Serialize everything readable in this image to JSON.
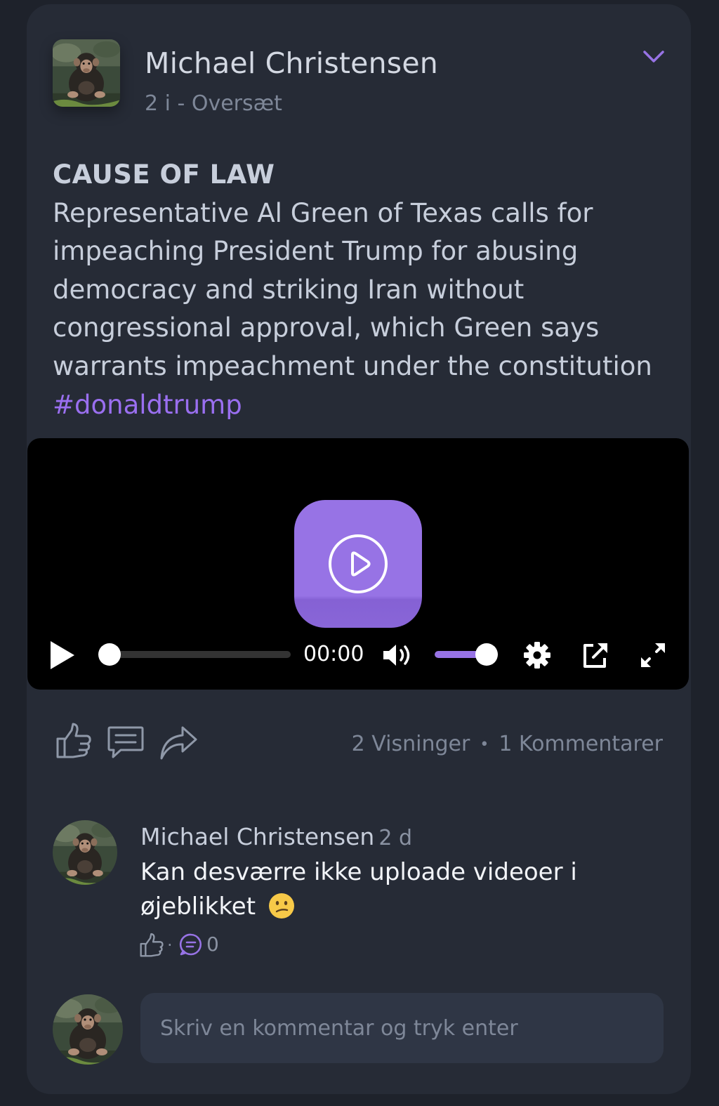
{
  "post": {
    "author": "Michael Christensen",
    "meta": "2 i - Oversæt",
    "headline": "CAUSE OF LAW",
    "body": "Representative Al Green of Texas calls for impeaching President Trump for abusing democracy and striking Iran without congressional approval, which Green says warrants impeachment under the constitution ",
    "hashtag": "#donaldtrump",
    "avatar_icon": "chimpanzee-photo",
    "menu_icon": "chevron-down-icon"
  },
  "video": {
    "time": "00:00",
    "progress_fraction": 0,
    "volume_fraction": 1,
    "icons": [
      "play-icon",
      "volume-icon",
      "settings-icon",
      "popout-icon",
      "fullscreen-icon"
    ]
  },
  "actions": {
    "icons": [
      "like-icon",
      "comment-icon",
      "share-icon"
    ],
    "views": "2 Visninger",
    "separator": "•",
    "comments": "1 Kommentarer"
  },
  "comment": {
    "author": "Michael Christensen",
    "time": "2 d",
    "text": "Kan desværre ikke uploade videoer i øjeblikket",
    "emoji": "confused-face",
    "like_separator": "·",
    "reply_count": "0"
  },
  "composer": {
    "placeholder": "Skriv en kommentar og tryk enter"
  },
  "colors": {
    "background": "#1e222b",
    "card": "#262b36",
    "accent": "#9773e5",
    "hashtag": "#9a6ff0",
    "muted": "#7e8798"
  }
}
